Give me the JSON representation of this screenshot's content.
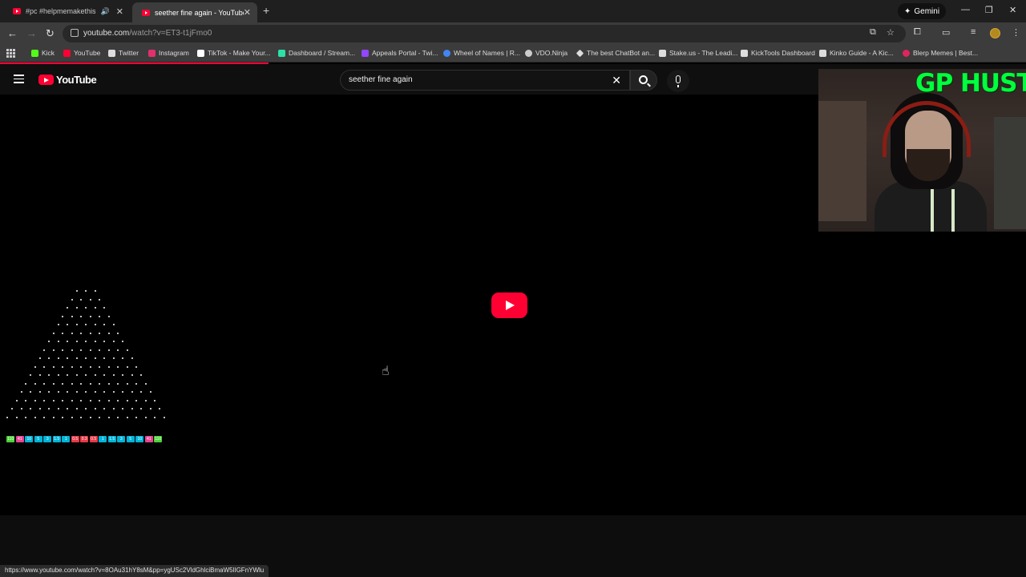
{
  "browser": {
    "tabs": [
      {
        "title": "#pc #helpmemakethismake",
        "audio": "🔊",
        "active": false
      },
      {
        "title": "seether fine again - YouTube",
        "active": true
      }
    ],
    "new_tab": "+",
    "gemini_label": "Gemini",
    "gemini_icon": "✦",
    "url_host": "youtube.com",
    "url_path": "/watch?v=ET3-t1jFmo0",
    "bookmarks": [
      {
        "label": "Kick",
        "color": "#53fc18"
      },
      {
        "label": "YouTube",
        "color": "#ff0033"
      },
      {
        "label": "Twitter",
        "color": "#dddddd"
      },
      {
        "label": "Instagram",
        "color": "#e1306c"
      },
      {
        "label": "TikTok - Make Your...",
        "color": "#ffffff"
      },
      {
        "label": "Dashboard / Stream...",
        "color": "#2de0a7"
      },
      {
        "label": "Appeals Portal - Twi...",
        "color": "#9146ff"
      },
      {
        "label": "Wheel of Names | R...",
        "color": "#4285f4"
      },
      {
        "label": "VDO.Ninja",
        "color": "#cccccc"
      },
      {
        "label": "The best ChatBot an...",
        "color": "#dddddd"
      },
      {
        "label": "Stake.us - The Leadi...",
        "color": "#dddddd"
      },
      {
        "label": "KickTools Dashboard",
        "color": "#dddddd"
      },
      {
        "label": "Kinko Guide - A Kic...",
        "color": "#dddddd"
      },
      {
        "label": "Blerp Memes | Best...",
        "color": "#e0245e"
      }
    ],
    "status_url": "https://www.youtube.com/watch?v=8OAu31hY8sM&pp=ygUSc2VldGhlciBmaW5lIGFnYWlu"
  },
  "youtube": {
    "logo_text": "YouTube",
    "search_query": "seether fine again",
    "accent": "#ff0033"
  },
  "plinko": {
    "multipliers": [
      "110",
      "41",
      "10",
      "5",
      "3",
      "1.5",
      "1",
      "0.5",
      "0.3",
      "0.5",
      "1",
      "1.5",
      "3",
      "5",
      "10",
      "41",
      "110"
    ]
  },
  "webcam": {
    "overlay_text": "GP HUSTLA"
  }
}
